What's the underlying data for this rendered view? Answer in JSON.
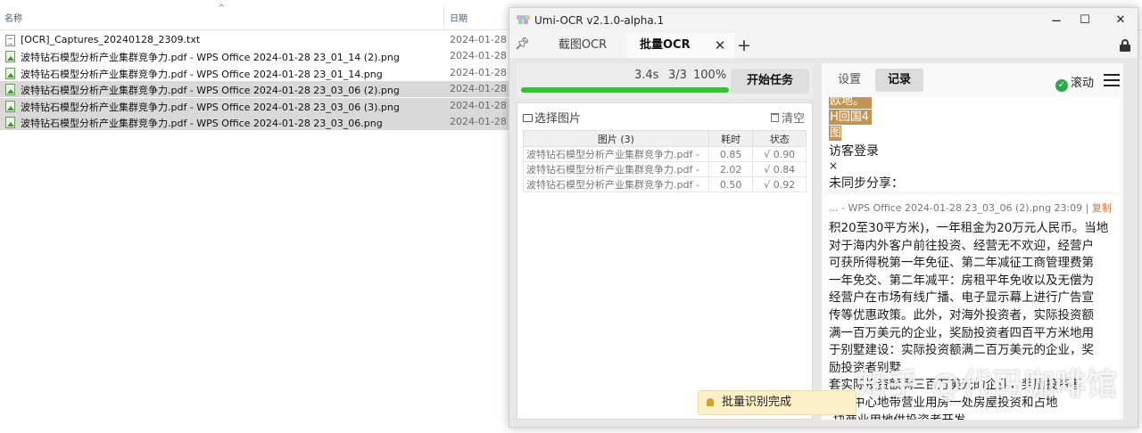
{
  "explorer": {
    "col_name": "名称",
    "col_date": "日期",
    "files": [
      {
        "name": "[OCR]_Captures_20240128_2309.txt",
        "date": "2024-01-28",
        "type": "txt",
        "selected": false
      },
      {
        "name": "波特钻石模型分析产业集群竞争力.pdf - WPS Office 2024-01-28 23_01_14 (2).png",
        "date": "2024-01-28",
        "type": "img",
        "selected": false
      },
      {
        "name": "波特钻石模型分析产业集群竞争力.pdf - WPS Office 2024-01-28 23_01_14.png",
        "date": "2024-01-28",
        "type": "img",
        "selected": false
      },
      {
        "name": "波特钻石模型分析产业集群竞争力.pdf - WPS Office 2024-01-28 23_03_06 (2).png",
        "date": "2024-01-28",
        "type": "img",
        "selected": true
      },
      {
        "name": "波特钻石模型分析产业集群竞争力.pdf - WPS Office 2024-01-28 23_03_06 (3).png",
        "date": "2024-01-28",
        "type": "img",
        "selected": true
      },
      {
        "name": "波特钻石模型分析产业集群竞争力.pdf - WPS Office 2024-01-28 23_03_06.png",
        "date": "2024-01-28",
        "type": "img",
        "selected": true
      }
    ]
  },
  "window": {
    "title": "Umi-OCR v2.1.0-alpha.1",
    "minimize": "−",
    "maximize": "☐",
    "close": "✕",
    "tabs": [
      {
        "label": "截图OCR",
        "active": false
      },
      {
        "label": "批量OCR",
        "active": true
      }
    ],
    "tab_close": "✕",
    "tab_add": "+"
  },
  "batch": {
    "time": "3.4s",
    "count": "3/3",
    "percent": "100%",
    "progress": 1.0,
    "start_button": "开始任务",
    "select_images": "选择图片",
    "clear": "清空",
    "table_headers": [
      "图片 (3)",
      "耗时",
      "状态"
    ],
    "rows": [
      {
        "name": "波特钻石模型分析产业集群竞争力.pdf -",
        "time": "0.85",
        "status": "√ 0.90"
      },
      {
        "name": "波特钻石模型分析产业集群竞争力.pdf -",
        "time": "2.02",
        "status": "√ 0.84"
      },
      {
        "name": "波特钻石模型分析产业集群竞争力.pdf -",
        "time": "0.50",
        "status": "√ 0.92"
      }
    ]
  },
  "results": {
    "tab_settings": "设置",
    "tab_records": "记录",
    "auto_scroll": "滚动",
    "highlight_lines": [
      "欧地。",
      "H回国4",
      "图"
    ],
    "prev_lines": [
      "访客登录",
      "×",
      "未同步分享："
    ],
    "entry_head": "... - WPS Office 2024-01-28 23_03_06 (2).png  23:09 | ",
    "copy_label": "复制",
    "entry_lines": [
      "积20至30平方米)，一年租金为20万元人民币。当地",
      "对于海内外客户前往投资、经营无不欢迎，经营户",
      "可获所得税第一年免征、第二年减征工商管理费第",
      "一年免交、第二年减平：房租平年免收以及无偿为",
      "经营户在市场有线广播、电子显示幕上进行广告宣",
      "传等优惠政策。此外，对海外投资者，实际投资额",
      "满一百万美元的企业，奖励投资者四百平方米地用",
      "于别墅建设：实际投资额满二百万美元的企业，奖",
      "励投资者别墅",
      "套实际投资额满三百万美元的企业，奖励投资者",
      "石桥中心地带营业用房一处房屋投资和占地",
      "-块商业用地供投资者开发。"
    ]
  },
  "toast": {
    "text": "批量识别完成"
  },
  "watermark": "知乎 @代码咖啡馆",
  "colors": {
    "progress": "#33c433",
    "highlight": "#c49552",
    "check": "#2ca84a",
    "copy": "#c87a3a"
  }
}
